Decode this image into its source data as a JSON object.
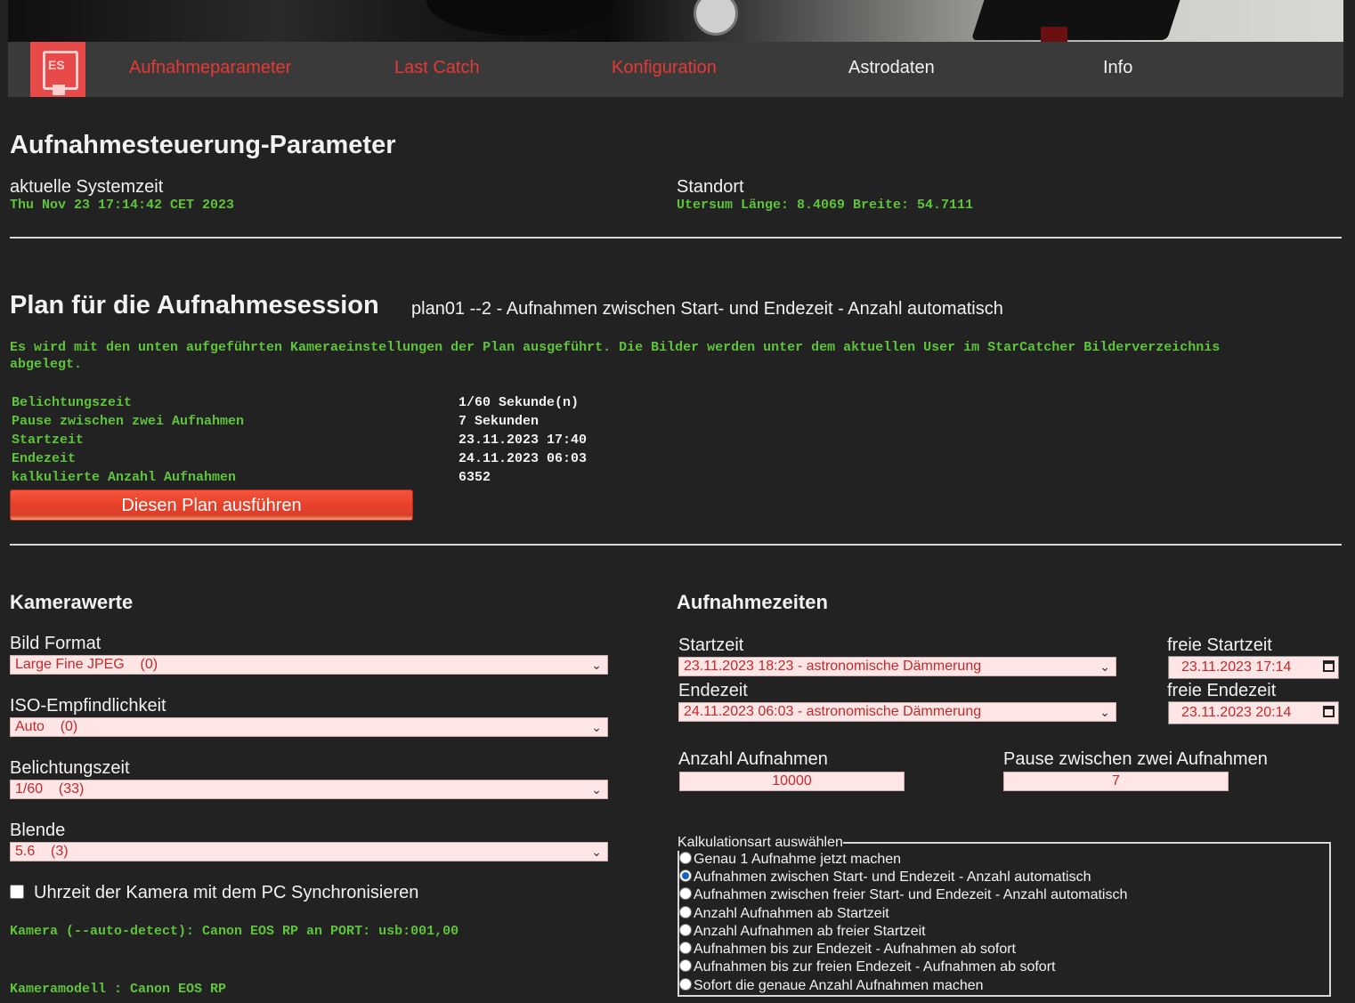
{
  "nav": {
    "logo_text": "ES",
    "items": [
      {
        "label": "Aufnahmeparameter",
        "color": "#e53935"
      },
      {
        "label": "Last Catch",
        "color": "#e53935"
      },
      {
        "label": "Konfiguration",
        "color": "#e53935"
      },
      {
        "label": "Astrodaten",
        "color": "#f2f2f2"
      },
      {
        "label": "Info",
        "color": "#f2f2f2"
      }
    ]
  },
  "params": {
    "title": "Aufnahmesteuerung-Parameter",
    "systime_label": "aktuelle Systemzeit",
    "systime_value": "Thu Nov 23 17:14:42 CET 2023",
    "location_label": "Standort",
    "location_value": "Utersum Länge: 8.4069 Breite: 54.7111"
  },
  "plan": {
    "title": "Plan für die Aufnahmesession",
    "subtitle": "plan01 --2 - Aufnahmen zwischen Start- und Endezeit - Anzahl automatisch",
    "info": "Es wird mit den unten aufgeführten Kameraeinstellungen der Plan ausgeführt. Die Bilder werden unter dem aktuellen User im StarCatcher Bilderverzeichnis abgelegt.",
    "rows": [
      {
        "key": "Belichtungszeit",
        "value": "1/60 Sekunde(n)"
      },
      {
        "key": "Pause zwischen zwei Aufnahmen",
        "value": "7 Sekunden"
      },
      {
        "key": "Startzeit",
        "value": "23.11.2023 17:40"
      },
      {
        "key": "Endezeit",
        "value": "24.11.2023 06:03"
      },
      {
        "key": "kalkulierte Anzahl Aufnahmen",
        "value": "6352"
      }
    ],
    "run_button": "Diesen Plan ausführen"
  },
  "camera": {
    "title": "Kamerawerte",
    "format_label": "Bild Format",
    "format_value": "Large Fine JPEG    (0)",
    "iso_label": "ISO-Empfindlichkeit",
    "iso_value": "Auto    (0)",
    "exposure_label": "Belichtungszeit",
    "exposure_value": "1/60    (33)",
    "aperture_label": "Blende",
    "aperture_value": "5.6    (3)",
    "sync_label": "Uhrzeit der Kamera mit dem PC Synchronisieren",
    "detect_text": "Kamera (--auto-detect): Canon EOS RP an PORT: usb:001,00",
    "model_text": "Kameramodell : Canon EOS RP"
  },
  "times": {
    "title": "Aufnahmezeiten",
    "start_label": "Startzeit",
    "start_value": "23.11.2023 18:23 - astronomische Dämmerung",
    "end_label": "Endezeit",
    "end_value": "24.11.2023 06:03 - astronomische Dämmerung",
    "free_start_label": "freie Startzeit",
    "free_start_value": "23.11.2023 17:14",
    "free_end_label": "freie Endezeit",
    "free_end_value": "23.11.2023 20:14",
    "count_label": "Anzahl Aufnahmen",
    "count_value": "10000",
    "pause_label": "Pause zwischen zwei Aufnahmen",
    "pause_value": "7",
    "calc_legend": "Kalkulationsart auswählen",
    "calc_options": [
      "Genau 1 Aufnahme jetzt machen",
      "Aufnahmen zwischen Start- und Endezeit - Anzahl automatisch",
      "Aufnahmen zwischen freier Start- und Endezeit - Anzahl automatisch",
      "Anzahl Aufnahmen ab Startzeit",
      "Anzahl Aufnahmen ab freier Startzeit",
      "Aufnahmen bis zur Endezeit - Aufnahmen ab sofort",
      "Aufnahmen bis zur freien Endezeit - Aufnahmen ab sofort",
      "Sofort die genaue Anzahl Aufnahmen machen"
    ],
    "calc_selected_index": 1
  }
}
